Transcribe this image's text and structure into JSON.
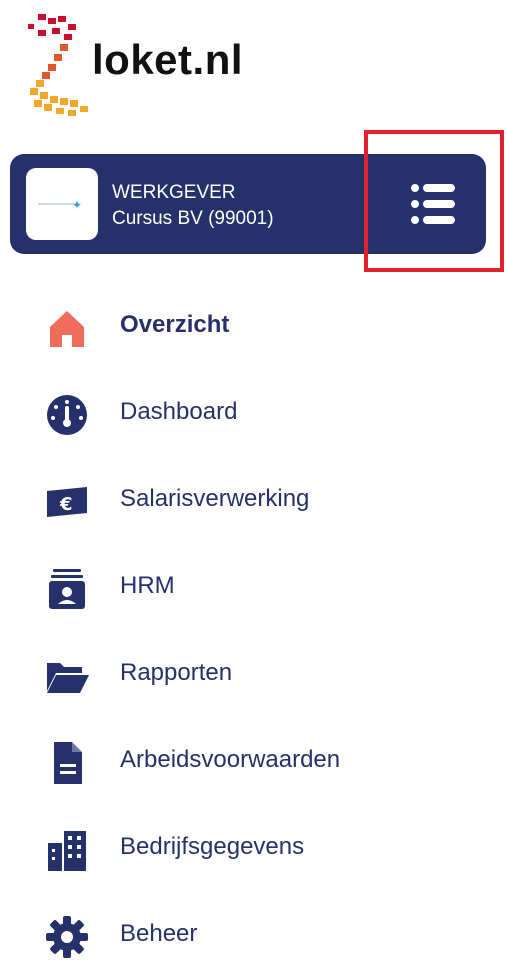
{
  "brand": {
    "name": "loket.nl"
  },
  "employer": {
    "type": "WERKGEVER",
    "name": "Cursus BV (99001)"
  },
  "menu_button": {
    "icon": "list-icon",
    "highlighted": true,
    "highlight_color": "#e0222a"
  },
  "colors": {
    "navy": "#26306b",
    "home_icon": "#f06c5c"
  },
  "nav": {
    "items": [
      {
        "label": "Overzicht",
        "icon": "home-icon",
        "active": true
      },
      {
        "label": "Dashboard",
        "icon": "gauge-icon"
      },
      {
        "label": "Salarisverwerking",
        "icon": "euro-bill-icon"
      },
      {
        "label": "HRM",
        "icon": "id-card-icon"
      },
      {
        "label": "Rapporten",
        "icon": "folder-open-icon"
      },
      {
        "label": "Arbeidsvoorwaarden",
        "icon": "document-icon"
      },
      {
        "label": "Bedrijfsgegevens",
        "icon": "building-icon"
      },
      {
        "label": "Beheer",
        "icon": "gear-icon"
      }
    ]
  }
}
